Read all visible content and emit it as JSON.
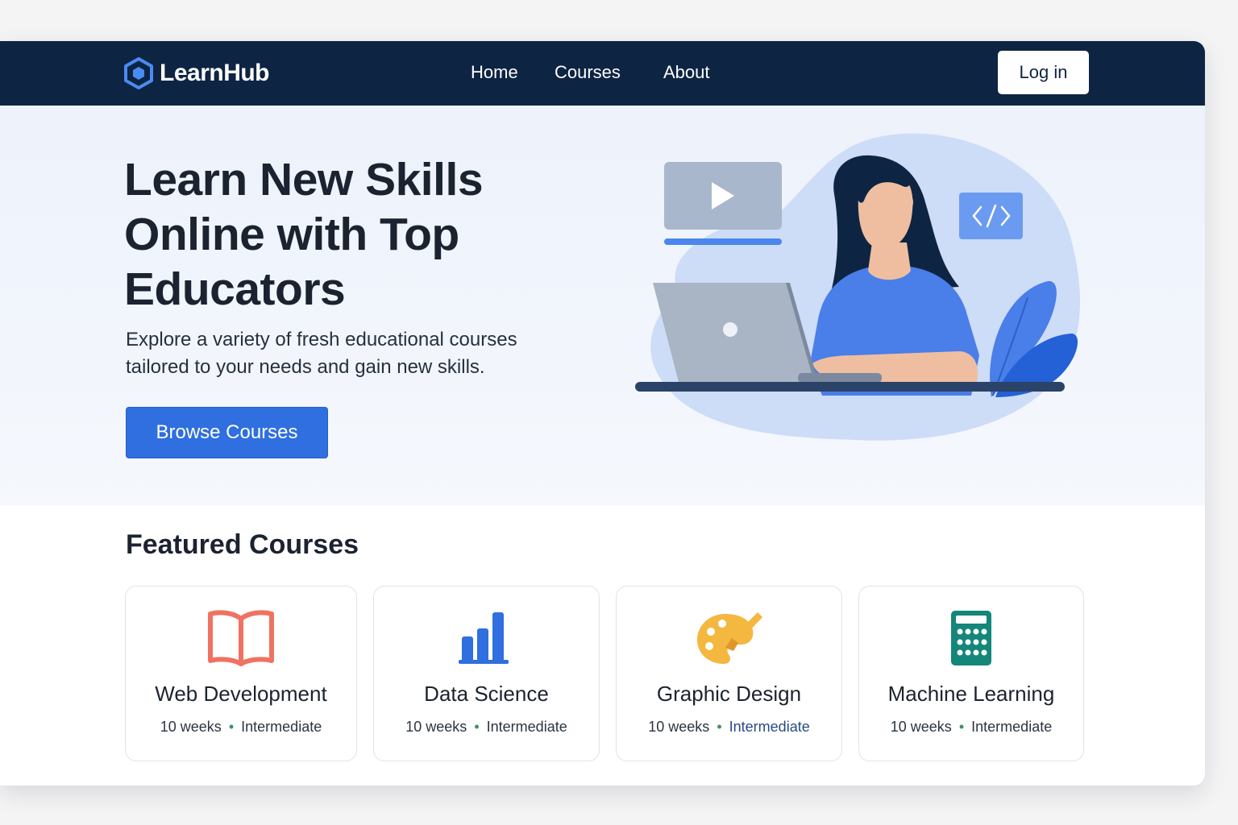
{
  "brand": {
    "name": "LearnHub"
  },
  "nav": {
    "items": [
      {
        "label": "Home"
      },
      {
        "label": "Courses"
      },
      {
        "label": "About"
      }
    ],
    "login_label": "Log in"
  },
  "hero": {
    "title_lines": [
      "Learn New Skills",
      "Online with Top",
      "Educators"
    ],
    "subtitle_lines": [
      "Explore a variety of fresh educational courses",
      "tailored to your needs and gain new skills."
    ],
    "cta_label": "Browse Courses"
  },
  "featured": {
    "title": "Featured Courses",
    "courses": [
      {
        "title": "Web Development",
        "duration": "10 weeks",
        "separator": "•",
        "level": "Intermediate",
        "icon": "book-icon",
        "icon_color": "#f07260"
      },
      {
        "title": "Data Science",
        "duration": "10 weeks",
        "separator": "•",
        "level": "Intermediate",
        "icon": "bar-chart-icon",
        "icon_color": "#2f6fdf"
      },
      {
        "title": "Graphic Design",
        "duration": "10 weeks",
        "separator": "•",
        "level": "Intermediate",
        "icon": "palette-icon",
        "icon_color": "#f4b740"
      },
      {
        "title": "Machine Learning",
        "duration": "10 weeks",
        "separator": "•",
        "level": "Intermediate",
        "icon": "calculator-icon",
        "icon_color": "#14867a"
      }
    ]
  },
  "colors": {
    "navbar": "#0e2443",
    "primary": "#2f6fdf",
    "hero_bg": "#edf2fb"
  }
}
